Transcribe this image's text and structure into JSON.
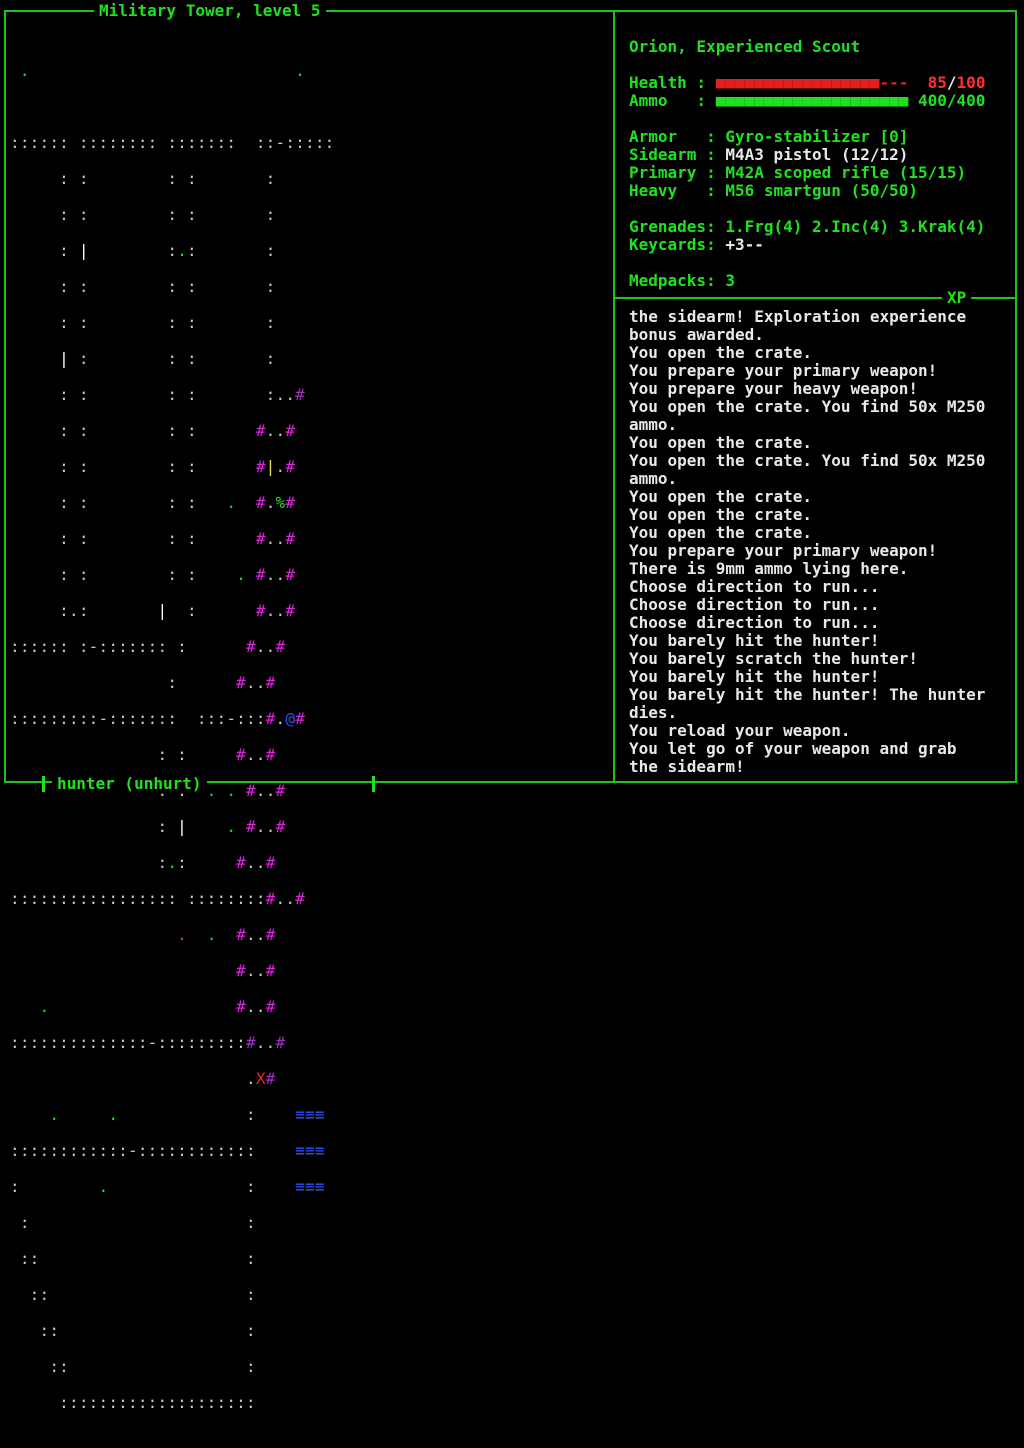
{
  "window": {
    "title": "Military Tower, level 5"
  },
  "player": {
    "name_line": "Orion, Experienced Scout",
    "health_label": "Health :",
    "health_bar_filled": "■■■■■■■■■■■■■■■■■",
    "health_bar_empty": "---",
    "health_current": "85",
    "health_sep": "/",
    "health_max": "100",
    "ammo_label": "Ammo   :",
    "ammo_bar": "■■■■■■■■■■■■■■■■■■■■",
    "ammo_value": "400/400",
    "armor_label": "Armor   :",
    "armor_value": "Gyro-stabilizer [0]",
    "sidearm_label": "Sidearm :",
    "sidearm_value": "M4A3 pistol (12/12)",
    "primary_label": "Primary :",
    "primary_value": "M42A scoped rifle (15/15)",
    "heavy_label": "Heavy   :",
    "heavy_value": "M56 smartgun (50/50)",
    "grenades_label": "Grenades:",
    "grenades_value": "1.Frg(4) 2.Inc(4) 3.Krak(4)",
    "keycards_label": "Keycards:",
    "keycards_value": "+3--",
    "medpacks_label": "Medpacks:",
    "medpacks_value": "3"
  },
  "log_panel": {
    "title": "XP",
    "lines": [
      "the sidearm! Exploration experience",
      "bonus awarded.",
      "You open the crate.",
      "You prepare your primary weapon!",
      "You prepare your heavy weapon!",
      "You open the crate. You find 50x M250",
      "ammo.",
      "You open the crate.",
      "You open the crate. You find 50x M250",
      "ammo.",
      "You open the crate.",
      "You open the crate.",
      "You open the crate.",
      "You prepare your primary weapon!",
      "There is 9mm ammo lying here.",
      "Choose direction to run...",
      "Choose direction to run...",
      "Choose direction to run...",
      "You barely hit the hunter!",
      "You barely scratch the hunter!",
      "You barely hit the hunter!",
      "You barely hit the hunter! The hunter",
      "dies.",
      "You reload your weapon.",
      "You let go of your weapon and grab",
      "the sidearm!"
    ]
  },
  "status_bar": {
    "target": "hunter (unhurt)"
  },
  "colors": {
    "frame": "#20c020",
    "text_green": "#20e020",
    "health_red": "#e02020",
    "wall_gray": "#c8c8c8",
    "corridor_magenta": "#e020e0",
    "enemy_blue": "#3050ff",
    "player_red": "#ff2020"
  },
  "map": {
    "rows": [
      "",
      " .                           .",
      "",
      ":::::: :::::::: :::::::  ::-:::",
      "     : :        : :       :",
      "     : :        : :       :",
      "     : |        :.:       :",
      "     : :        : :       :",
      "     : :        : :       :",
      "     | :        : :       :",
      "     : :        : :       :..",
      "     : :        : :      ..",
      "     : :        : :      |..",
      "     : :        : :   .  ..%",
      "     : :        : :      ..",
      "     : :        : :    . ..",
      "     :.:       |  :      ..",
      "::::: :-::::::: :      ..",
      "                       ..",
      "::::::::-:::::::  :::-:::..@",
      "               : :     ..",
      "               : :  . . ..",
      "               : |    . ..",
      "               :.:     ..",
      "::::::::::::::::: :::::::..",
      "                 .  .  ..",
      "                       ..",
      "   .                   ..",
      "::::::::::::::-:::::::::..",
      "                        .X",
      "    .     .             :",
      "::::::::::::-::::::::::::",
      ":        .              :",
      " :                      :",
      " ::                     :",
      "  ::                    :",
      "   ::                   :",
      "    ::                  :",
      "     ::::::::::::::::::::"
    ]
  }
}
